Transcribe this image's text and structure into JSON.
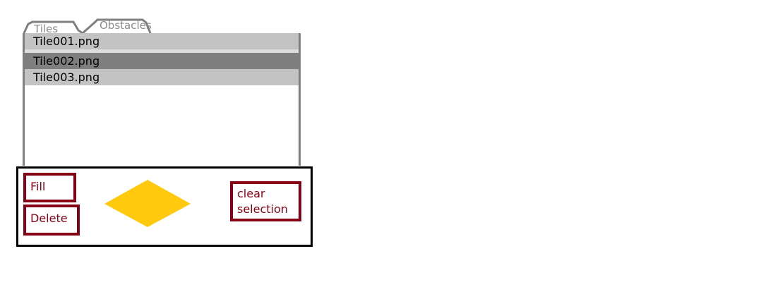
{
  "tabs": [
    {
      "label": "Tiles",
      "active": true
    },
    {
      "label": "Obstacles",
      "active": false
    }
  ],
  "tile_list": {
    "items": [
      {
        "label": "Tile001.png",
        "selected": false
      },
      {
        "label": "Tile002.png",
        "selected": true
      },
      {
        "label": "Tile003.png",
        "selected": false
      }
    ]
  },
  "toolbar": {
    "fill_label": "Fill",
    "delete_label": "Delete",
    "clear_label_line1": "clear",
    "clear_label_line2": "selection",
    "preview_icon": "diamond-tile-preview"
  },
  "colors": {
    "tab_outline": "#7f7f7f",
    "row_bg": "#c3c3c3",
    "row_selected_bg": "#7f7f7f",
    "button_accent": "#880015",
    "diamond_fill": "#ffc90e",
    "frame": "#000000"
  }
}
